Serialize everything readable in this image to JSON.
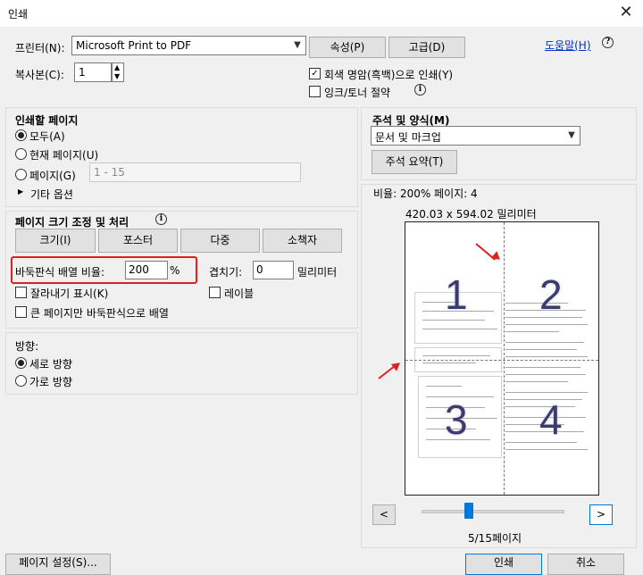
{
  "window": {
    "title": "인쇄",
    "close_glyph": "✕"
  },
  "printer": {
    "label": "프린터(N):",
    "selected": "Microsoft Print to PDF",
    "properties_button": "속성(P)",
    "advanced_button": "고급(D)",
    "help_link": "도움말(H)"
  },
  "copies": {
    "label": "복사본(C):",
    "value": "1"
  },
  "options": {
    "grayscale": {
      "label": "회색 명암(흑백)으로 인쇄(Y)",
      "checked": true
    },
    "save_ink": {
      "label": "잉크/토너 절약",
      "checked": false
    }
  },
  "pages_to_print": {
    "title": "인쇄할 페이지",
    "all": "모두(A)",
    "current": "현재 페이지(U)",
    "pages": "페이지(G)",
    "pages_value": "1 - 15",
    "more_options": "기타 옵션"
  },
  "page_sizing": {
    "title": "페이지 크기 조정 및 처리",
    "buttons": [
      "크기(I)",
      "포스터",
      "다중",
      "소책자"
    ],
    "tile_scale_label": "바둑판식 배열 비율:",
    "tile_scale_value": "200",
    "tile_scale_unit": "%",
    "overlap_label": "겹치기:",
    "overlap_value": "0",
    "overlap_unit": "밀리미터",
    "cut_marks": "잘라내기 표시(K)",
    "labels": "레이블",
    "tile_large_only": "큰 페이지만 바둑판식으로 배열"
  },
  "orientation": {
    "title": "방향:",
    "portrait": "세로 방향",
    "landscape": "가로 방향"
  },
  "comments_forms": {
    "title": "주석 및 양식(M)",
    "selected": "문서 및 마크업",
    "summarize_button": "주석 요약(T)"
  },
  "preview": {
    "scale_info": "비율: 200% 페이지: 4",
    "size_info": "420.03 x 594.02 밀리미터",
    "tiles": [
      "1",
      "2",
      "3",
      "4"
    ],
    "prev_button": "<",
    "next_button": ">",
    "page_indicator": "5/15페이지",
    "slider_fraction": 0.33
  },
  "footer": {
    "page_setup_button": "페이지 설정(S)...",
    "print_button": "인쇄",
    "cancel_button": "취소"
  },
  "colors": {
    "highlight": "#e02020",
    "accent_blue": "#0078d7"
  }
}
